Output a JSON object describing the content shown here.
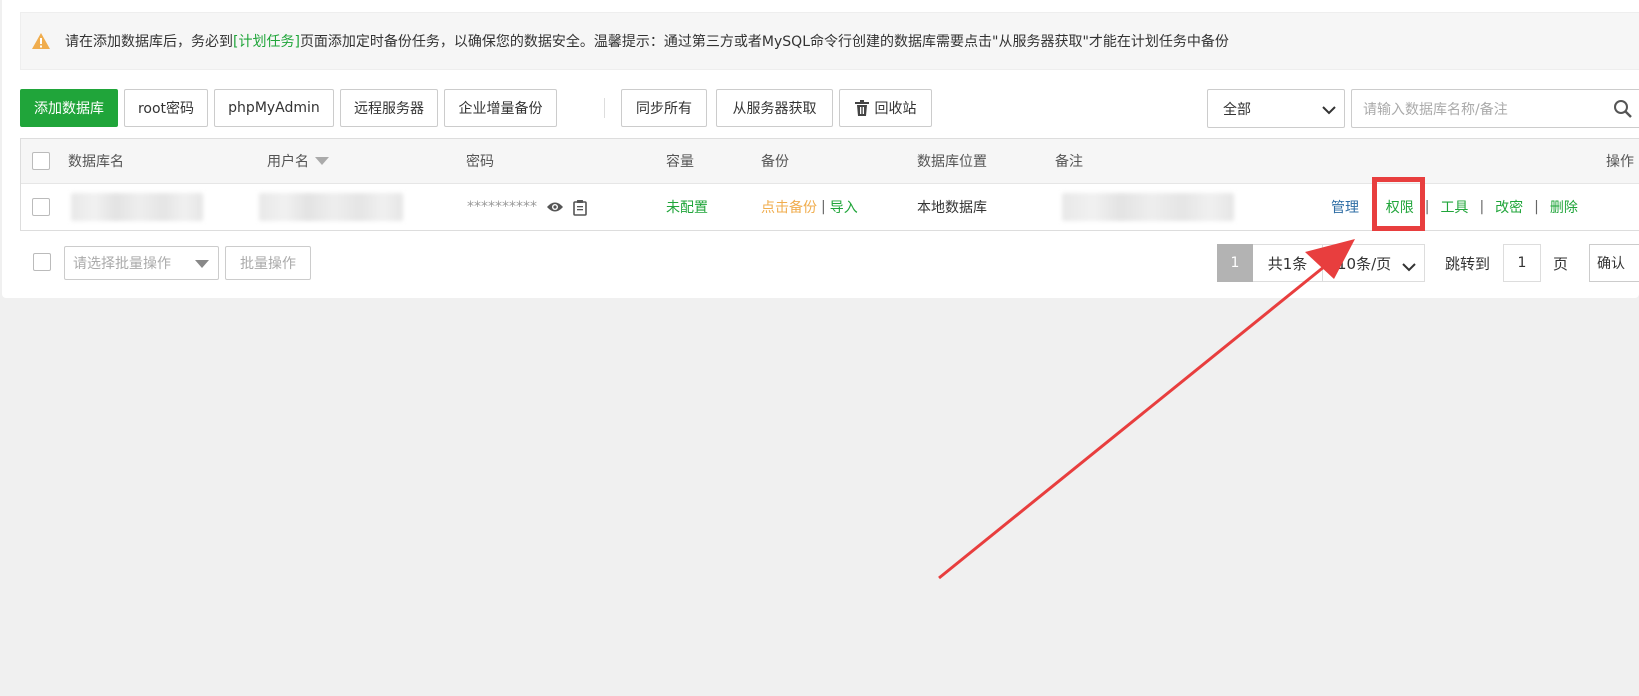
{
  "alert": {
    "icon": "warning-icon",
    "prefix": "请在添加数据库后，务必到",
    "link": "[计划任务]",
    "suffix": "页面添加定时备份任务，以确保您的数据安全。温馨提示：通过第三方或者MySQL命令行创建的数据库需要点击\"从服务器获取\"才能在计划任务中备份"
  },
  "toolbar": {
    "add_db": "添加数据库",
    "root_password": "root密码",
    "phpmyadmin": "phpMyAdmin",
    "remote_server": "远程服务器",
    "incremental_backup": "企业增量备份",
    "sync_all": "同步所有",
    "fetch_from_server": "从服务器获取",
    "recycle_bin": "回收站"
  },
  "filter": {
    "selected": "全部",
    "search_placeholder": "请输入数据库名称/备注"
  },
  "table": {
    "headers": {
      "name": "数据库名",
      "username": "用户名",
      "password": "密码",
      "capacity": "容量",
      "backup": "备份",
      "location": "数据库位置",
      "remark": "备注",
      "actions": "操作"
    },
    "rows": [
      {
        "password_mask": "**********",
        "capacity": "未配置",
        "backup_link": "点击备份",
        "backup_sep": "|",
        "import_link": "导入",
        "location": "本地数据库",
        "actions": {
          "manage": "管理",
          "permissions": "权限",
          "tools": "工具",
          "change_password": "改密",
          "delete": "删除",
          "sep": "|"
        }
      }
    ]
  },
  "footer": {
    "batch_placeholder": "请选择批量操作",
    "batch_button": "批量操作",
    "current_page": "1",
    "total": "共1条",
    "page_size": "10条/页",
    "jump_label": "跳转到",
    "jump_value": "1",
    "page_unit": "页",
    "confirm": "确认"
  },
  "colors": {
    "primary": "#20a53a",
    "warning": "#f0ad4e",
    "highlight": "#e83e3e",
    "link_blue": "#2e6da4"
  }
}
